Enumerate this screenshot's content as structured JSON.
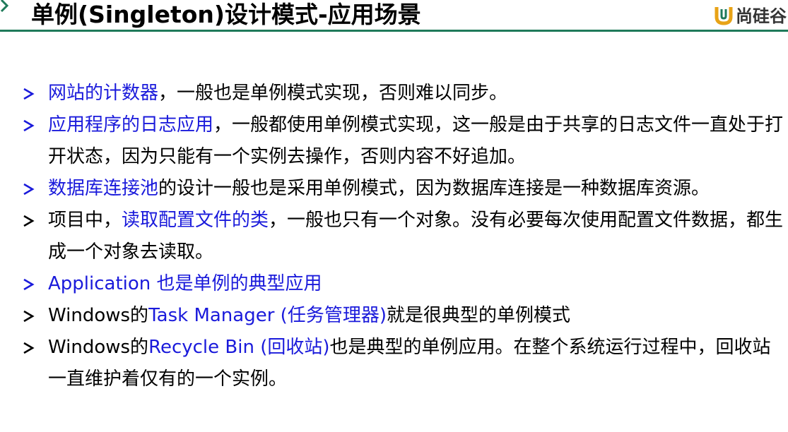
{
  "header": {
    "title": "单例(Singleton)设计模式-应用场景",
    "logo_text": "尚硅谷",
    "accent_color": "#1f7a5a",
    "logo_color": "#e8a317"
  },
  "bullets": [
    {
      "parts": [
        {
          "text": "网站的计数器",
          "blue": true
        },
        {
          "text": "，一般也是单例模式实现，否则难以同步。",
          "blue": false
        }
      ]
    },
    {
      "parts": [
        {
          "text": "应用程序的日志应用",
          "blue": true
        },
        {
          "text": "，一般都使用单例模式实现，这一般是由于共享的日志文件一直处于打开状态，因为只能有一个实例去操作，否则内容不好追加。",
          "blue": false
        }
      ]
    },
    {
      "parts": [
        {
          "text": "数据库连接池",
          "blue": true
        },
        {
          "text": "的设计一般也是采用单例模式，因为数据库连接是一种数据库资源。",
          "blue": false
        }
      ]
    },
    {
      "parts": [
        {
          "text": "项目中，",
          "blue": false
        },
        {
          "text": "读取配置文件的类",
          "blue": true
        },
        {
          "text": "，一般也只有一个对象。没有必要每次使用配置文件数据，都生成一个对象去读取。",
          "blue": false
        }
      ]
    },
    {
      "parts": [
        {
          "text": "Application 也是单例的典型应用",
          "blue": true
        }
      ]
    },
    {
      "parts": [
        {
          "text": "Windows的",
          "blue": false
        },
        {
          "text": "Task Manager (任务管理器)",
          "blue": true
        },
        {
          "text": "就是很典型的单例模式",
          "blue": false
        }
      ]
    },
    {
      "parts": [
        {
          "text": "Windows的",
          "blue": false
        },
        {
          "text": "Recycle Bin (回收站)",
          "blue": true
        },
        {
          "text": "也是典型的单例应用。在整个系统运行过程中，回收站一直维护着仅有的一个实例。",
          "blue": false
        }
      ]
    }
  ]
}
